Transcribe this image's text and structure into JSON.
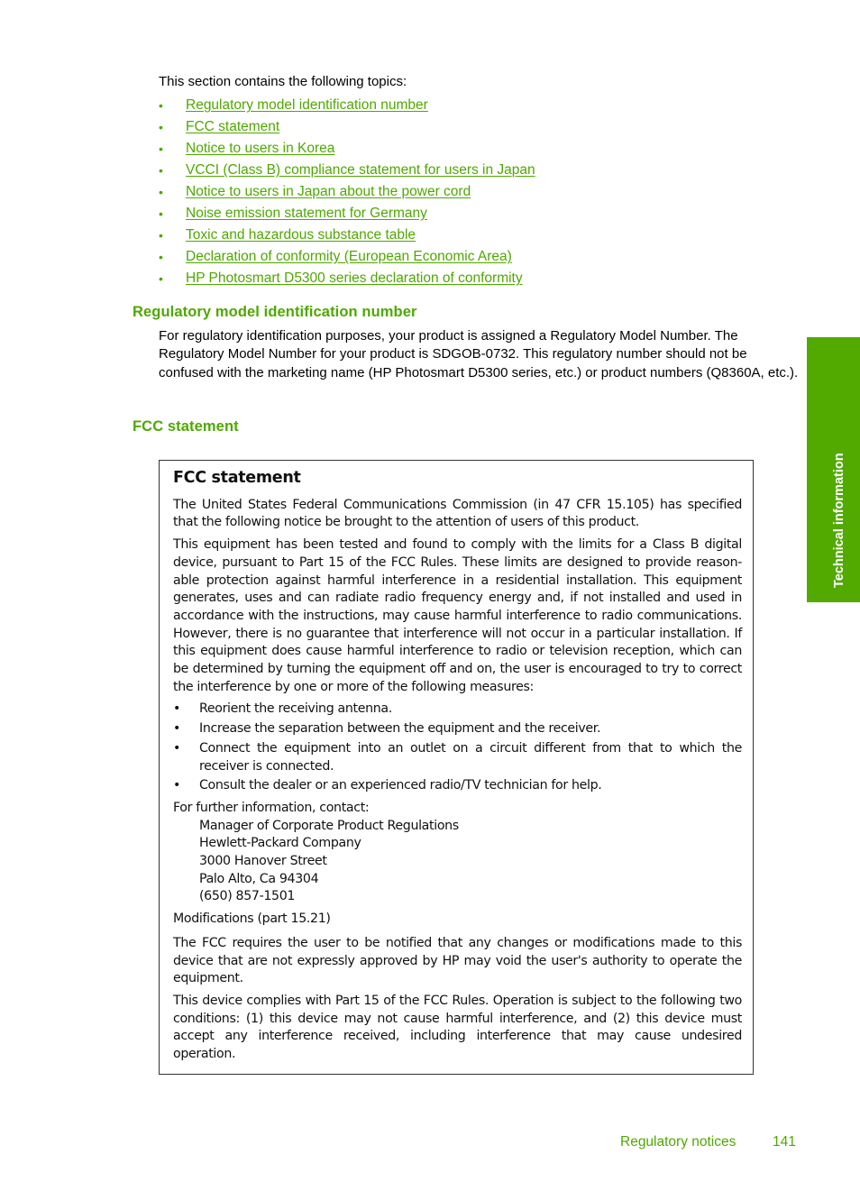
{
  "intro": "This section contains the following topics:",
  "toc": [
    "Regulatory model identification number",
    "FCC statement",
    "Notice to users in Korea",
    "VCCI (Class B) compliance statement for users in Japan",
    "Notice to users in Japan about the power cord",
    "Noise emission statement for Germany",
    "Toxic and hazardous substance table",
    "Declaration of conformity (European Economic Area)",
    "HP Photosmart D5300 series declaration of conformity"
  ],
  "regulatory": {
    "heading": "Regulatory model identification number",
    "text": "For regulatory identification purposes, your product is assigned a Regulatory Model Number. The Regulatory Model Number for your product is SDGOB-0732. This regulatory number should not be confused with the marketing name (HP Photosmart D5300 series, etc.) or product numbers (Q8360A, etc.)."
  },
  "fcc": {
    "heading": "FCC statement",
    "box_title": "FCC statement",
    "p1": "The United States Federal Communications Commission (in 47 CFR 15.105) has specified that the following notice be brought to the attention of users of this product.",
    "p2": "This equipment has been tested and found to comply with the limits for a Class B digital device, pursuant to Part 15 of the FCC Rules.  These limits are designed to provide reason-able protection against harmful interference in a residential installation.  This equipment generates, uses and can radiate radio frequency energy and, if not installed and used in accordance with the instructions, may cause harmful interference to radio communications. However, there is no guarantee that interference will not occur in a particular installation. If this equipment does cause harmful interference to radio or television reception, which can be determined by turning the equipment off and on, the user is encouraged to try to correct the interference by one or more of the following measures:",
    "measures": [
      "Reorient the receiving antenna.",
      "Increase the separation between the equipment and the receiver.",
      "Connect the equipment into an outlet on a circuit different from that to which the receiver is connected.",
      "Consult the dealer or an experienced radio/TV technician for help."
    ],
    "contact_intro": "For further information, contact:",
    "contact": [
      "Manager of Corporate Product Regulations",
      "Hewlett-Packard Company",
      "3000 Hanover Street",
      "Palo Alto, Ca 94304",
      "(650) 857-1501"
    ],
    "modifications": "Modifications (part 15.21)",
    "p3": "The FCC requires the user to be notified that any changes or modifications made to this device that are not expressly approved by HP may void the user's authority to operate the equipment.",
    "p4": "This device complies with Part 15 of the FCC Rules.  Operation is subject to the following two conditions:  (1) this device may not cause harmful interference, and (2) this device must accept any interference received, including interference that may cause undesired operation."
  },
  "side_tab": "Technical information",
  "footer": {
    "section": "Regulatory notices",
    "page": "141"
  },
  "colors": {
    "accent": "#4fa800",
    "tab": "#52aa00"
  }
}
